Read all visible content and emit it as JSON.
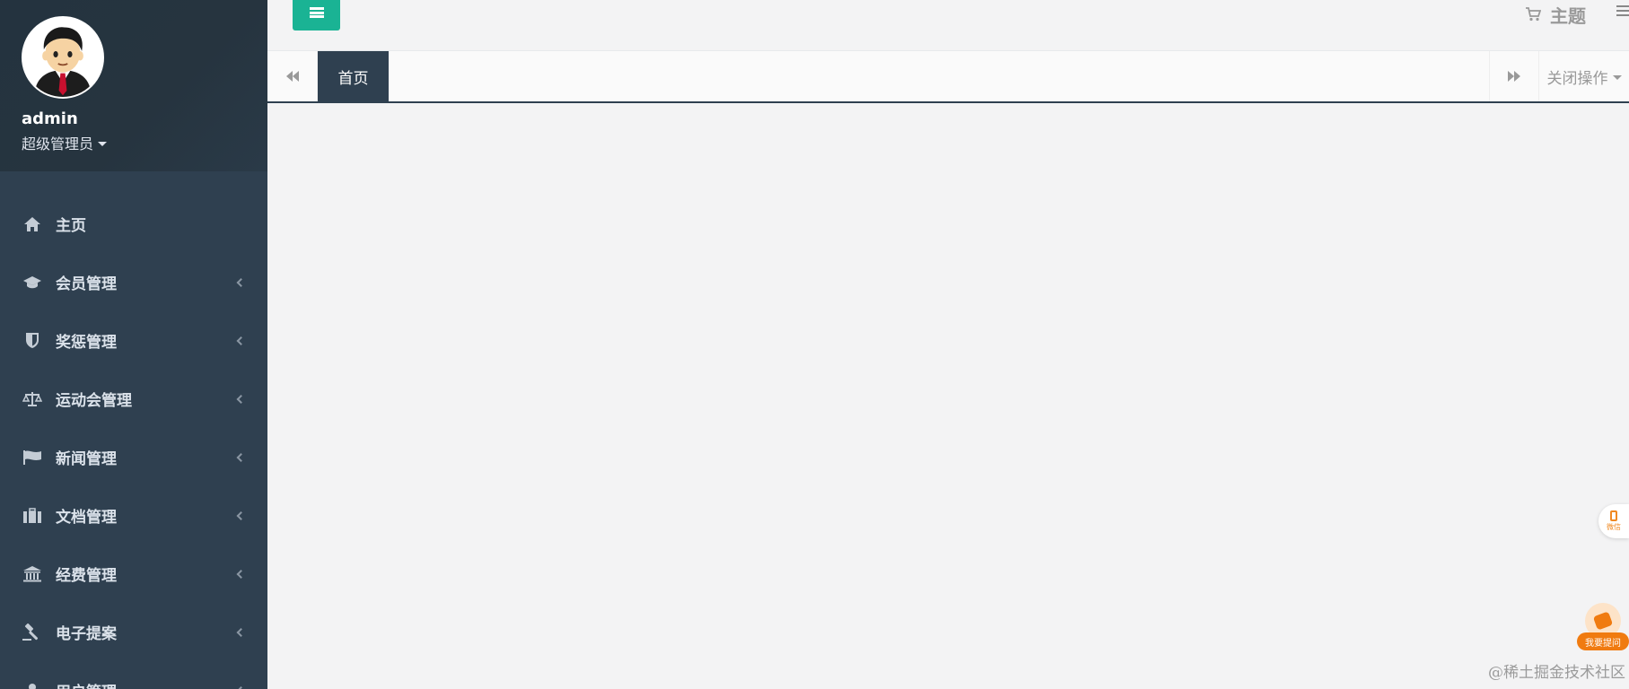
{
  "profile": {
    "name": "admin",
    "role": "超级管理员"
  },
  "sidebar": {
    "items": [
      {
        "label": "主页",
        "icon": "home-icon",
        "has_submenu": false
      },
      {
        "label": "会员管理",
        "icon": "graduation-cap-icon",
        "has_submenu": true
      },
      {
        "label": "奖惩管理",
        "icon": "shield-icon",
        "has_submenu": true
      },
      {
        "label": "运动会管理",
        "icon": "balance-scale-icon",
        "has_submenu": true
      },
      {
        "label": "新闻管理",
        "icon": "flag-icon",
        "has_submenu": true
      },
      {
        "label": "文档管理",
        "icon": "briefcase-icon",
        "has_submenu": true
      },
      {
        "label": "经费管理",
        "icon": "bank-icon",
        "has_submenu": true
      },
      {
        "label": "电子提案",
        "icon": "gavel-icon",
        "has_submenu": true
      },
      {
        "label": "用户管理",
        "icon": "user-icon",
        "has_submenu": true
      }
    ]
  },
  "topbar": {
    "menu_toggle_icon": "hamburger-icon",
    "theme_label": "主题",
    "theme_icon": "cart-icon"
  },
  "tabs": {
    "prev_icon": "double-left-icon",
    "items": [
      {
        "label": "首页",
        "active": true
      }
    ],
    "next_icon": "double-right-icon",
    "close_ops_label": "关闭操作"
  },
  "floating": {
    "wechat_label": "微信",
    "ask_label": "我要提问"
  },
  "watermark": "@稀土掘金技术社区",
  "colors": {
    "sidebar_bg": "#2f4050",
    "accent": "#1ab394",
    "content_bg": "#f3f3f4",
    "float_accent": "#f07b10"
  }
}
